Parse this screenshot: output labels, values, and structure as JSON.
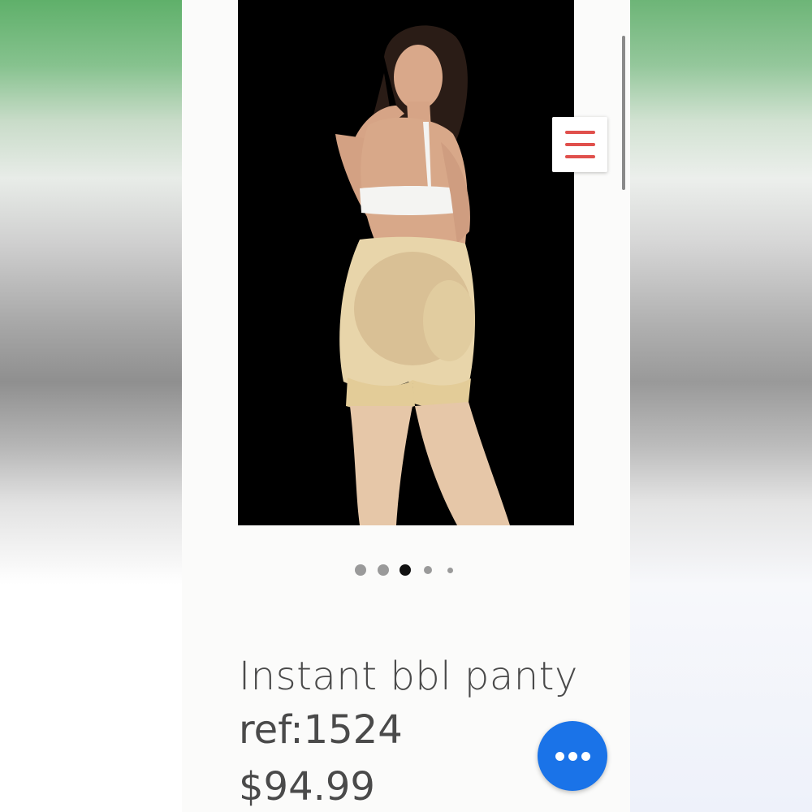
{
  "product": {
    "title": "Instant bbl panty",
    "ref": "ref:1524",
    "price": "$94.99"
  },
  "hero_image": {
    "description_icon": "product-photo"
  },
  "carousel": {
    "slide_count": 5,
    "active_index": 2
  },
  "menu_button": {
    "icon": "hamburger-menu-icon"
  },
  "chat_button": {
    "icon": "more-dots-icon"
  },
  "colors": {
    "menu_accent": "#e0504c",
    "chat_blue": "#1a73e8",
    "text": "#4a4a4a",
    "dot_inactive": "#9a9a9a",
    "dot_active": "#111111"
  }
}
